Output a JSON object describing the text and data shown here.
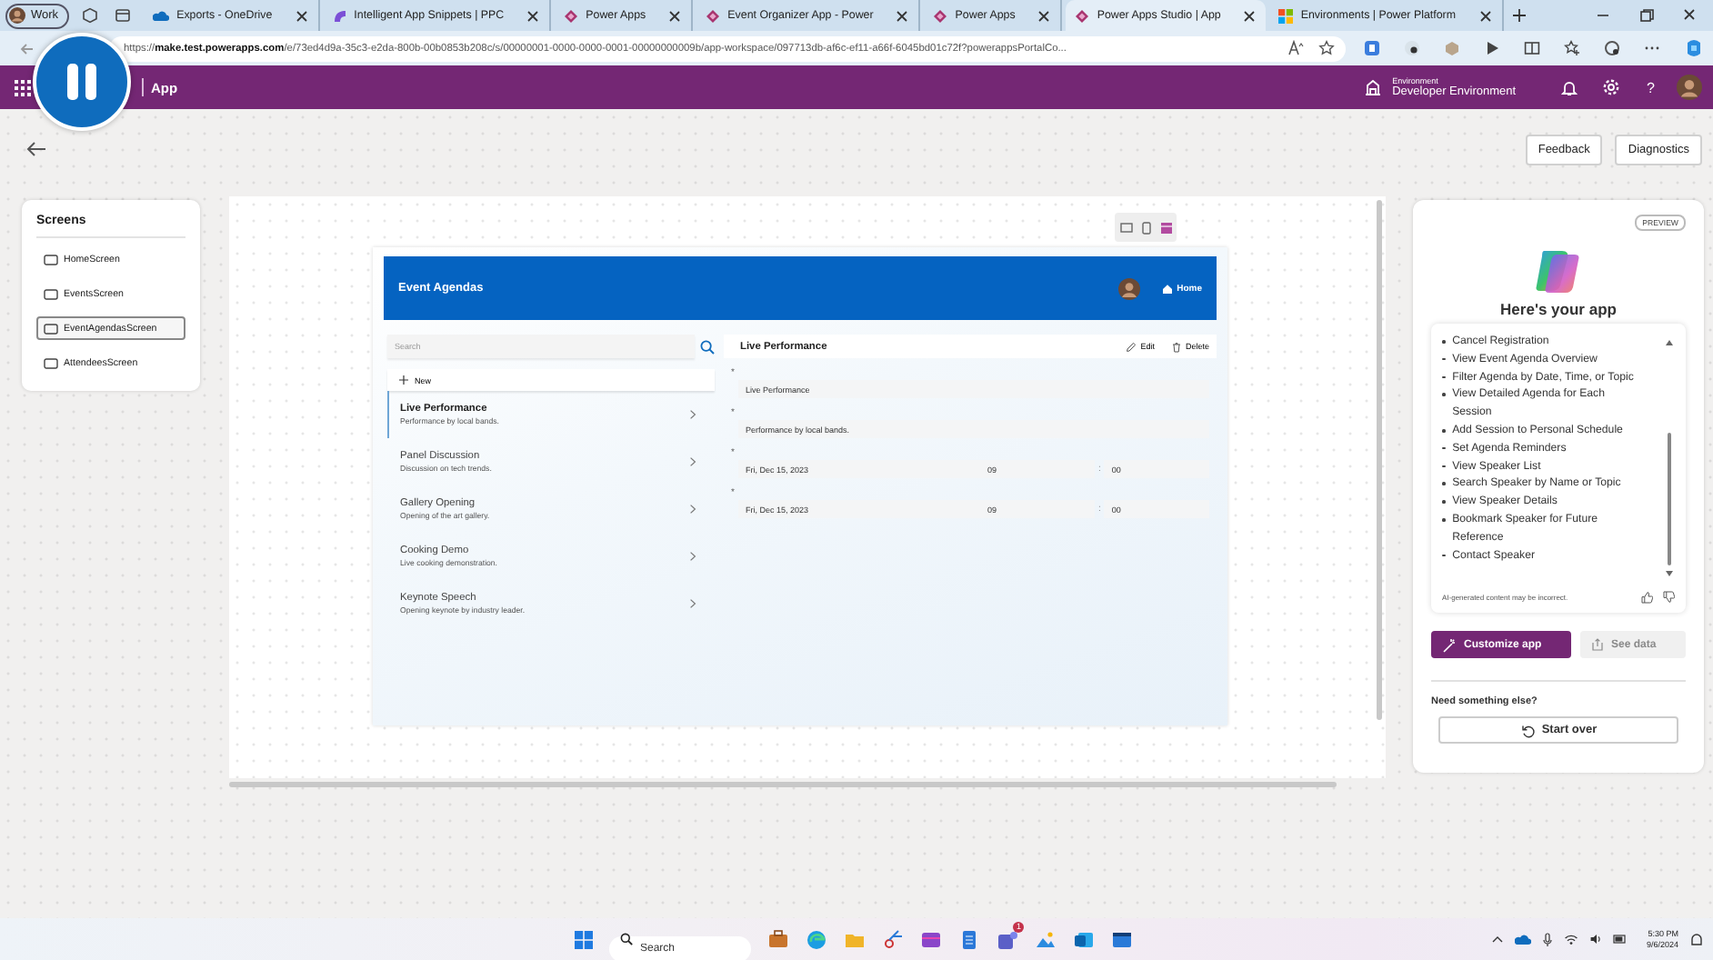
{
  "browser": {
    "profile": "Work",
    "tabs": [
      {
        "title": "Exports - OneDrive",
        "selected": false
      },
      {
        "title": "Intelligent App Snippets | PPC",
        "selected": false
      },
      {
        "title": "Power Apps",
        "selected": false
      },
      {
        "title": "Event Organizer App - Power",
        "selected": false
      },
      {
        "title": "Power Apps",
        "selected": false
      },
      {
        "title": "Power Apps Studio | App",
        "selected": true
      },
      {
        "title": "Environments | Power Platform",
        "selected": false
      }
    ],
    "address": "https://**make.test.powerapps.com**/e/73ed4d9a-35c3-e2da-800b-00b0853b208c/s/00000001-0000-0000-0001-00000000009b/app-workspace/097713db-af6c-ef11-a66f-6045bd01c72f?powerappsPortalCo..."
  },
  "header": {
    "app": "App",
    "environment_label": "Environment",
    "environment": "Developer Environment",
    "help": "?"
  },
  "toolbar": {
    "buttons": [
      "Feedback",
      "Diagnostics"
    ]
  },
  "screens": {
    "title": "Screens",
    "items": [
      {
        "name": "HomeScreen",
        "selected": false
      },
      {
        "name": "EventsScreen",
        "selected": false
      },
      {
        "name": "EventAgendasScreen",
        "selected": true
      },
      {
        "name": "AttendeesScreen",
        "selected": false
      }
    ]
  },
  "app": {
    "title": "Event Agendas",
    "home": "Home",
    "search": {
      "placeholder": "Search"
    },
    "new": "New",
    "items": [
      {
        "title": "Live Performance",
        "subtitle": "Performance by local bands.",
        "selected": true
      },
      {
        "title": "Panel Discussion",
        "subtitle": "Discussion on tech trends.",
        "selected": false
      },
      {
        "title": "Gallery Opening",
        "subtitle": "Opening of the art gallery.",
        "selected": false
      },
      {
        "title": "Cooking Demo",
        "subtitle": "Live cooking demonstration.",
        "selected": false
      },
      {
        "title": "Keynote Speech",
        "subtitle": "Opening keynote by industry leader.",
        "selected": false
      }
    ],
    "detail": {
      "title": "Live Performance",
      "actions": [
        "Edit",
        "Delete"
      ],
      "fields": [
        {
          "kind": "text",
          "mark": "*",
          "value": "Live Performance"
        },
        {
          "kind": "text",
          "mark": "*",
          "value": "Performance by local bands."
        },
        {
          "kind": "datetime",
          "mark": "*",
          "date": "Fri, Dec 15, 2023",
          "hour": "09",
          "separator": ":",
          "minute": "00"
        },
        {
          "kind": "datetime",
          "mark": "*",
          "date": "Fri, Dec 15, 2023",
          "hour": "09",
          "separator": ":",
          "minute": "00"
        }
      ]
    }
  },
  "copilot": {
    "badge": "PREVIEW",
    "title": "Here's your app",
    "features": [
      "Cancel Registration",
      "View Event Agenda Overview",
      "Filter Agenda by Date, Time, or Topic",
      "View Detailed Agenda for Each Session",
      "Add Session to Personal Schedule",
      "Set Agenda Reminders",
      "View Speaker List",
      "Search Speaker by Name or Topic",
      "View Speaker Details",
      "Bookmark Speaker for Future Reference",
      "Contact Speaker"
    ],
    "disclaimer": "AI-generated content may be incorrect.",
    "buttons": [
      {
        "label": "Customize app",
        "kind": "primary",
        "disabled": false
      },
      {
        "label": "See data",
        "kind": "secondary",
        "disabled": true
      }
    ],
    "prompt": "Need something else?",
    "start_over": "Start over"
  },
  "taskbar": {
    "search": {
      "placeholder": "Search"
    },
    "badge": "1",
    "time": "5:30 PM",
    "date": "9/6/2024"
  }
}
